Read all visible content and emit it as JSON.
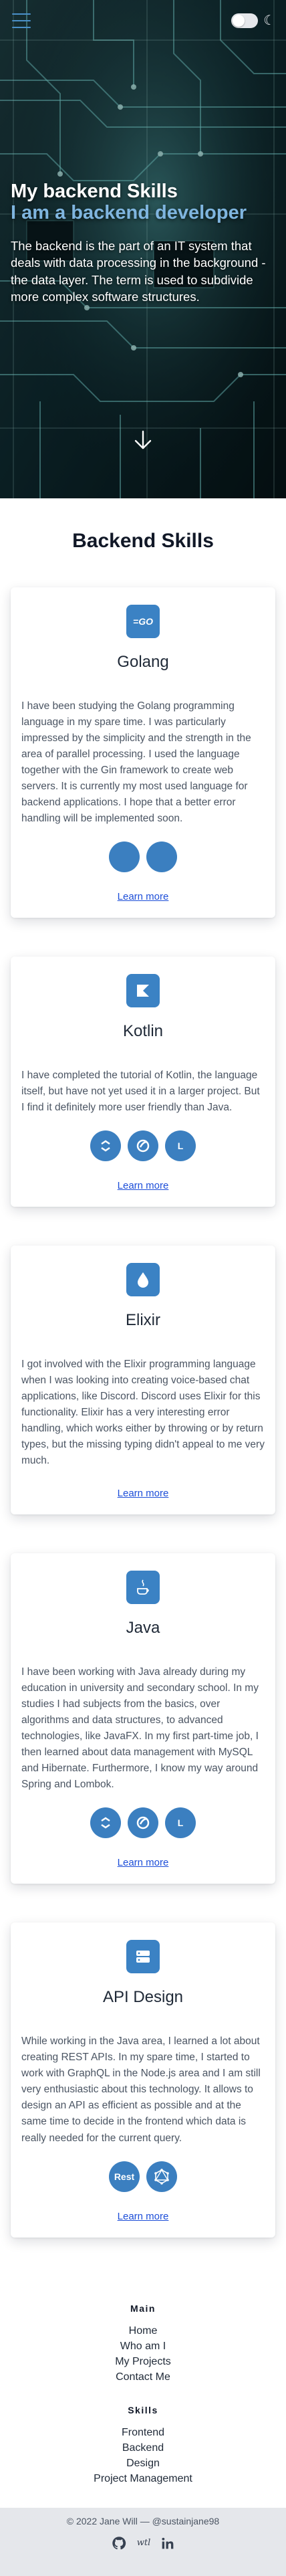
{
  "header": {
    "menu_icon": "hamburger-menu-icon",
    "theme_icon": "moon-icon"
  },
  "hero": {
    "title": "My backend Skills",
    "subtitle": "I am a backend developer",
    "description": "The backend is the part of an IT system that deals with data processing in the background - the data layer. The term is used to subdivide more complex software structures.",
    "scroll_icon": "arrow-down-icon",
    "accent_color": "#7fb5df"
  },
  "section": {
    "title": "Backend Skills"
  },
  "skills": [
    {
      "icon": "go-icon",
      "name": "Golang",
      "text": "I have been studying the Golang programming language in my spare time. I was particularly impressed by the simplicity and the strength in the area of parallel processing. I used the language together with the Gin framework to create web servers. It is currently my most used language for backend applications. I hope that a better error handling will be implemented soon.",
      "techs": [
        "",
        ""
      ],
      "link": "Learn more"
    },
    {
      "icon": "kotlin-icon",
      "name": "Kotlin",
      "text": "I have completed the tutorial of Kotlin, the language itself, but have not yet used it in a larger project. But I find it definitely more user friendly than Java.",
      "techs": [
        "",
        "",
        "L"
      ],
      "link": "Learn more"
    },
    {
      "icon": "elixir-drop-icon",
      "name": "Elixir",
      "text": "I got involved with the Elixir programming language when I was looking into creating voice-based chat applications, like Discord. Discord uses Elixir for this functionality. Elixir has a very interesting error handling, which works either by throwing or by return types, but the missing typing didn't appeal to me very much.",
      "techs": [],
      "link": "Learn more"
    },
    {
      "icon": "java-cup-icon",
      "name": "Java",
      "text": "I have been working with Java already during my education in university and secondary school. In my studies I had subjects from the basics, over algorithms and data structures, to advanced technologies, like JavaFX. In my first part-time job, I then learned about data management with MySQL and Hibernate. Furthermore, I know my way around Spring and Lombok.",
      "techs": [
        "",
        "",
        "L"
      ],
      "link": "Learn more"
    },
    {
      "icon": "api-server-icon",
      "name": "API Design",
      "text": "While working in the Java area, I learned a lot about creating REST APIs. In my spare time, I started to work with GraphQL in the Node.js area and I am still very enthusiastic about this technology. It allows to design an API as efficient as possible and at the same time to decide in the frontend which data is really needed for the current query.",
      "techs": [
        "Rest",
        ""
      ],
      "link": "Learn more"
    }
  ],
  "footer": {
    "main_heading": "Main",
    "main_links": [
      "Home",
      "Who am I",
      "My Projects",
      "Contact Me"
    ],
    "skills_heading": "Skills",
    "skills_links": [
      "Frontend",
      "Backend",
      "Design",
      "Project Management"
    ],
    "copyright": "© 2022 Jane Will — @sustainjane98",
    "social_icons": [
      "github-icon",
      "wtl-icon",
      "linkedin-icon"
    ],
    "wtl_label": "wtl"
  }
}
